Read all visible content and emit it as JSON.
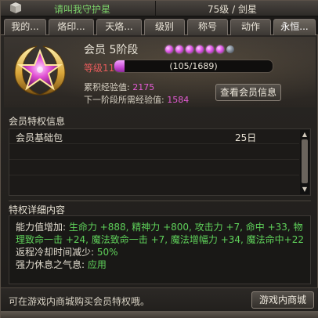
{
  "topbar": {
    "guard_text": "请叫我守护星",
    "level_text": "75级 / 剑星"
  },
  "tabs": [
    {
      "label": "我的..."
    },
    {
      "label": "烙印..."
    },
    {
      "label": "天烙..."
    },
    {
      "label": "级别"
    },
    {
      "label": "称号"
    },
    {
      "label": "动作"
    },
    {
      "label": "永恒..."
    }
  ],
  "active_tab_index": 6,
  "member": {
    "rank_title": "会员 5阶段",
    "rank_dots_filled": 6,
    "rank_dots_total": 7,
    "level_label": "等级11",
    "exp_text": "(105/1689)",
    "exp_fraction": 0.062,
    "accum_label": "累积经验值: ",
    "accum_value": "2175",
    "next_label": "下一阶段所需经验值: ",
    "next_value": "1584",
    "view_button": "查看会员信息"
  },
  "privilege": {
    "header": "会员特权信息",
    "rows": [
      {
        "name": "会员基础包",
        "days": "25日"
      }
    ]
  },
  "detail": {
    "header": "特权详细内容",
    "line1_label": "能力值增加: ",
    "line1_value": "生命力 +888, 精神力 +800, 攻击力 +7, 命中 +33, 物理致命一击 +24, 魔法致命一击 +7, 魔法增幅力 +34, 魔法命中+22",
    "line2_label": "返程冷却时间减少: ",
    "line2_value": "50%",
    "line3_label": "强力休息之气息: ",
    "line3_value": "应用"
  },
  "footer": {
    "note": "可在游戏内商城购买会员特权哦。",
    "shop_button": "游戏内商城"
  },
  "colors": {
    "accent_purple": "#c94ad6",
    "green": "#5fd15a",
    "red_label": "#e65b5b"
  }
}
